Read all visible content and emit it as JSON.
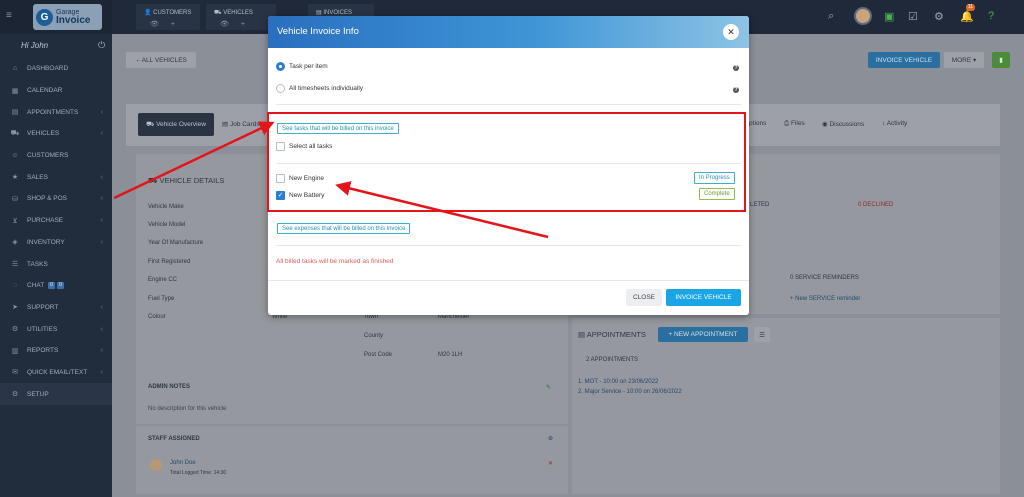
{
  "sidebar": {
    "brand_small": "Garage",
    "brand_big": "Invoice",
    "greeting": "Hi John",
    "items": [
      {
        "label": "DASHBOARD",
        "icon": "home-icon",
        "chevron": false
      },
      {
        "label": "CALENDAR",
        "icon": "calendar-icon",
        "chevron": false
      },
      {
        "label": "APPOINTMENTS",
        "icon": "appointments-icon",
        "chevron": true
      },
      {
        "label": "VEHICLES",
        "icon": "car-icon",
        "chevron": true
      },
      {
        "label": "CUSTOMERS",
        "icon": "user-icon",
        "chevron": false
      },
      {
        "label": "SALES",
        "icon": "star-icon",
        "chevron": true
      },
      {
        "label": "SHOP & POS",
        "icon": "shop-icon",
        "chevron": true
      },
      {
        "label": "PURCHASE",
        "icon": "cart-icon",
        "chevron": true
      },
      {
        "label": "INVENTORY",
        "icon": "box-icon",
        "chevron": true
      },
      {
        "label": "TASKS",
        "icon": "tasks-icon",
        "chevron": false
      },
      {
        "label": "CHAT",
        "icon": "chat-icon",
        "chevron": false
      },
      {
        "label": "SUPPORT",
        "icon": "support-icon",
        "chevron": true
      },
      {
        "label": "UTILITIES",
        "icon": "cogs-icon",
        "chevron": true
      },
      {
        "label": "REPORTS",
        "icon": "reports-icon",
        "chevron": true
      },
      {
        "label": "QUICK EMAIL/TEXT",
        "icon": "email-icon",
        "chevron": true
      },
      {
        "label": "SETUP",
        "icon": "gear-icon",
        "chevron": false
      }
    ],
    "chat_badges": [
      "0",
      "0"
    ]
  },
  "topbar": {
    "groups": [
      "CUSTOMERS",
      "VEHICLES",
      "INVOICES"
    ],
    "notification_count": "11"
  },
  "page": {
    "back_label": "ALL VEHICLES",
    "invoice_vehicle_label": "INVOICE VEHICLE",
    "more_label": "MORE",
    "tabs": [
      "Vehicle Overview",
      "Job Cards",
      "Options",
      "Files",
      "Discussions",
      "Activity"
    ],
    "vehicle_details_title": "VEHICLE DETAILS",
    "detail_labels": [
      "Vehicle Make",
      "Vehicle Model",
      "Year Of Manufacture",
      "First Registered",
      "Engine CC",
      "Fuel Type",
      "Colour"
    ],
    "colour_value": "White",
    "address_labels": [
      "Town",
      "County",
      "Post Code"
    ],
    "town_value": "Manchester",
    "postcode_value": "M20 1LH",
    "completed_label": "LETED",
    "declined_label": "0 DECLINED",
    "service_reminders": "0 SERVICE REMINDERS",
    "new_service_reminder": "+ New SERVICE reminder",
    "admin_notes_title": "ADMIN NOTES",
    "admin_notes_body": "No description for this vehicle",
    "staff_title": "STAFF ASSIGNED",
    "staff_name": "John Doe",
    "staff_logged": "Total Logged Time: 14:30",
    "appointments_title": "APPOINTMENTS",
    "new_appointment_label": "+ NEW APPOINTMENT",
    "appointments_count": "2 APPOINTMENTS",
    "appointment_items": [
      "1. MOT - 10:00 on 23/06/2022",
      "2. Major Service - 10:00 on 26/06/2022"
    ]
  },
  "modal": {
    "title": "Vehicle Invoice Info",
    "option_task_per_item": "Task per item",
    "option_all_timesheets": "All timesheets individually",
    "see_tasks_label": "See tasks that will be billed on this invoice",
    "select_all_label": "Select all tasks",
    "tasks": [
      {
        "name": "New Engine",
        "status": "In Progress",
        "checked": false
      },
      {
        "name": "New Battery",
        "status": "Complete",
        "checked": true
      }
    ],
    "see_expenses_label": "See expenses that will be billed on this invoice",
    "warning": "All billed tasks will be marked as finished",
    "close_label": "CLOSE",
    "invoice_label": "INVOICE VEHICLE"
  },
  "colors": {
    "accent": "#1aa5e6",
    "annotation": "#e3151a",
    "header_start": "#2a6fbf",
    "sidebar_bg": "#212c3d"
  }
}
